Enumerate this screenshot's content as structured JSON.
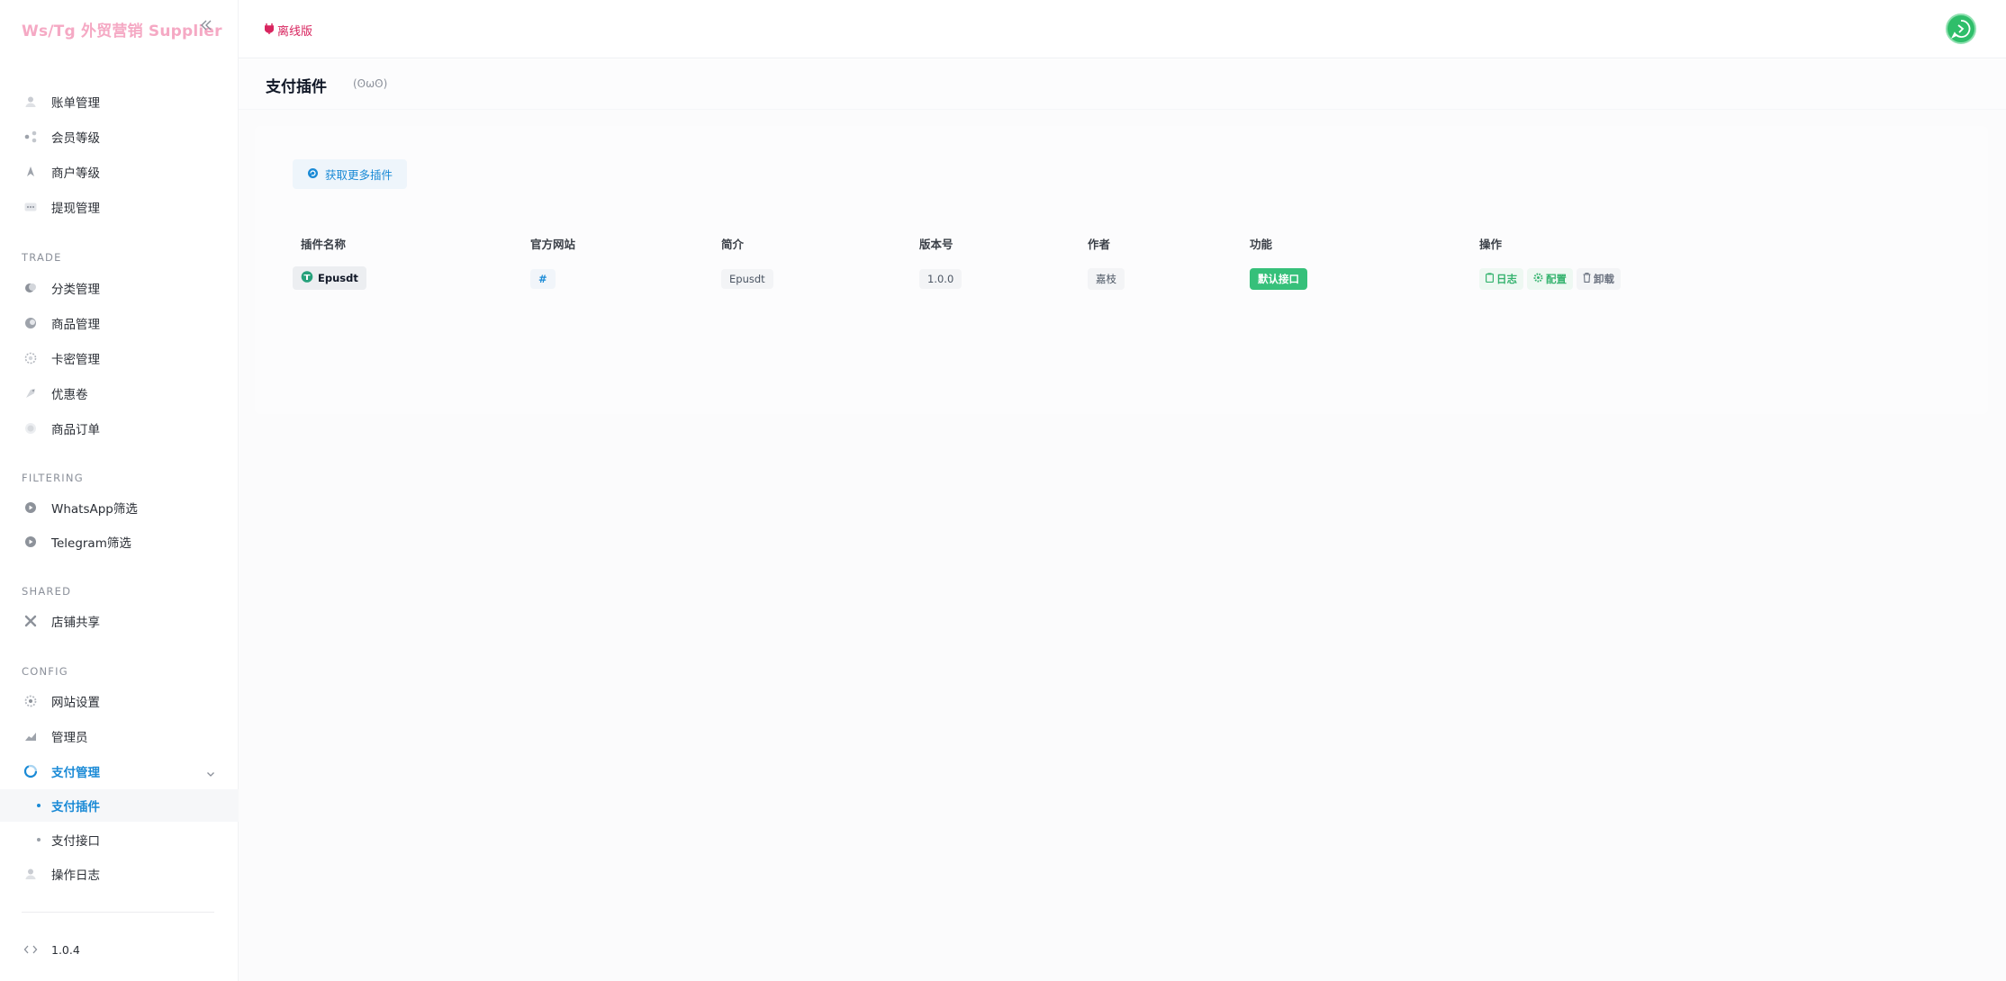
{
  "app": {
    "brand": "Ws/Tg 外贸营销 Supplier",
    "version": "1.0.4"
  },
  "topbar": {
    "offline_label": "离线版"
  },
  "sidebar": {
    "group1": [
      {
        "label": "账单管理",
        "icon": "user-icon"
      },
      {
        "label": "会员等级",
        "icon": "share-icon"
      },
      {
        "label": "商户等级",
        "icon": "rocket-icon"
      },
      {
        "label": "提现管理",
        "icon": "dots-icon"
      }
    ],
    "sections": {
      "trade": "TRADE",
      "filtering": "FILTERING",
      "shared": "SHARED",
      "config": "CONFIG"
    },
    "trade": [
      {
        "label": "分类管理",
        "icon": "category-icon"
      },
      {
        "label": "商品管理",
        "icon": "goods-icon"
      },
      {
        "label": "卡密管理",
        "icon": "gear-icon"
      },
      {
        "label": "优惠卷",
        "icon": "coupon-icon"
      },
      {
        "label": "商品订单",
        "icon": "order-icon"
      }
    ],
    "filtering": [
      {
        "label": "WhatsApp筛选",
        "icon": "play-icon"
      },
      {
        "label": "Telegram筛选",
        "icon": "play-icon"
      }
    ],
    "shared": [
      {
        "label": "店铺共享",
        "icon": "tools-icon"
      }
    ],
    "config": [
      {
        "label": "网站设置",
        "icon": "settings-icon"
      },
      {
        "label": "管理员",
        "icon": "admin-icon"
      },
      {
        "label": "支付管理",
        "icon": "payment-icon"
      },
      {
        "label": "支付插件",
        "icon": "dot-icon"
      },
      {
        "label": "支付接口",
        "icon": "dot-icon"
      },
      {
        "label": "操作日志",
        "icon": "log-icon"
      }
    ]
  },
  "page": {
    "title": "支付插件",
    "subtitle": "(ʘωʘ)"
  },
  "toolbar": {
    "more_plugins_label": "获取更多插件"
  },
  "table": {
    "headers": [
      "插件名称",
      "官方网站",
      "简介",
      "版本号",
      "作者",
      "功能",
      "操作"
    ],
    "rows": [
      {
        "name": "Epusdt",
        "website": "#",
        "intro": "Epusdt",
        "version": "1.0.0",
        "author": "嘉枝",
        "feature": "默认接口",
        "actions": {
          "log": "日志",
          "config": "配置",
          "uninstall": "卸载"
        }
      }
    ]
  },
  "colors": {
    "accent": "#1a8ad6",
    "brand": "#f5a9c4",
    "offline": "#d8255f",
    "success": "#36c07a"
  }
}
